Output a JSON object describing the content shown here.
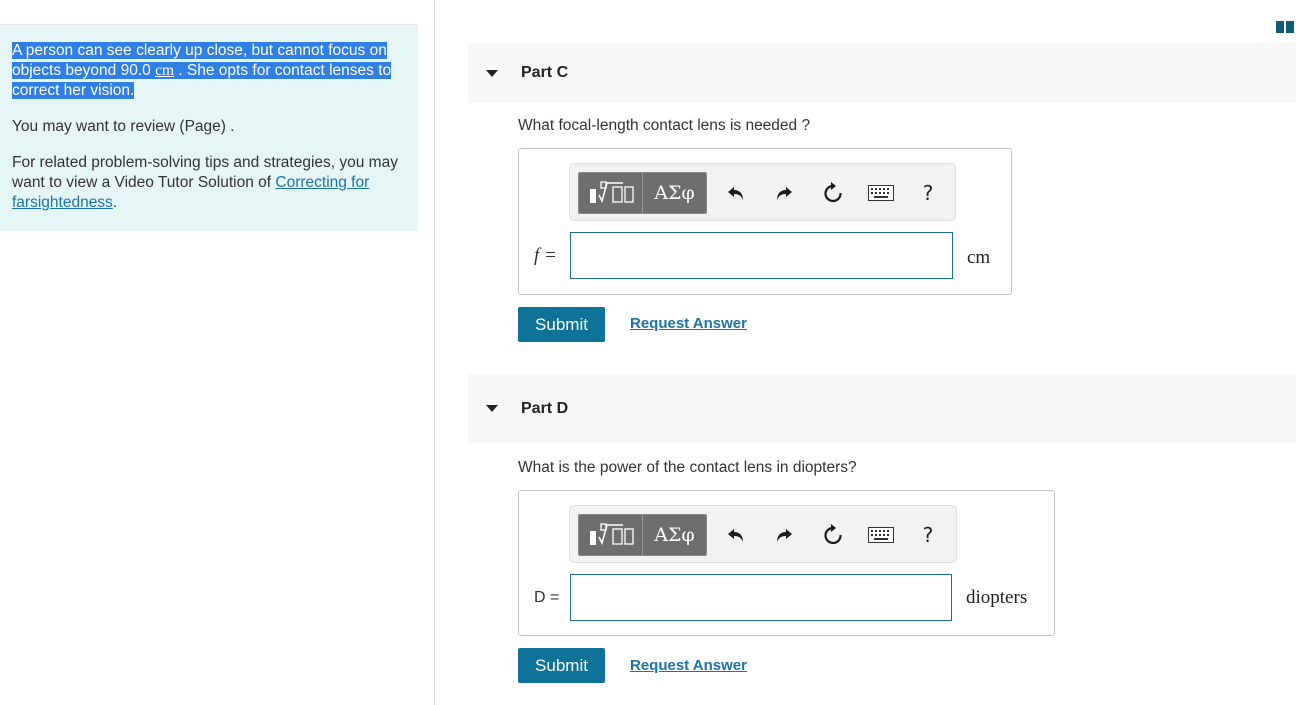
{
  "problem": {
    "text_before": "A person can see clearly up close, but cannot focus on objects beyond 90.0 ",
    "unit": "cm",
    "text_after": " . She opts for contact lenses to correct her vision.",
    "review_text": "You may want to review (Page) .",
    "related_text": "For related problem-solving tips and strategies, you may want to view a Video Tutor Solution of ",
    "related_link": "Correcting for farsightedness",
    "related_end": "."
  },
  "toolbar": {
    "greek_label": "ΑΣφ",
    "help_label": "?",
    "icons": [
      "templates-icon",
      "greek-letters-icon",
      "undo-icon",
      "redo-icon",
      "reset-icon",
      "keyboard-icon",
      "help-icon"
    ]
  },
  "parts": [
    {
      "title": "Part C",
      "question": "What focal-length contact lens is needed ?",
      "variable": "f =",
      "value": "",
      "unit": "cm",
      "submit_label": "Submit",
      "request_label": "Request Answer"
    },
    {
      "title": "Part D",
      "question": "What is the power of the contact lens in diopters?",
      "variable": "D =",
      "value": "",
      "unit": "diopters",
      "submit_label": "Submit",
      "request_label": "Request Answer"
    }
  ],
  "colors": {
    "accent": "#0f7399",
    "link": "#1b74a8",
    "highlight": "#2f7fe6",
    "panel_bg": "#e6f5f6"
  }
}
